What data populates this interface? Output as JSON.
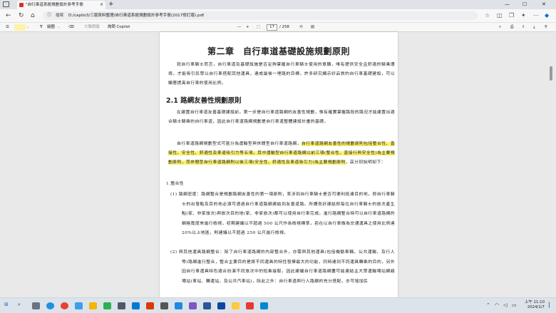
{
  "browser": {
    "tab_title": "\"自行車道系統規劃設計參考手冊",
    "tab_close": "×",
    "new_tab": "+",
    "window_minimize": "—",
    "window_maximize": "☐",
    "window_close": "✕",
    "address_label": "檔案",
    "address_path": "D:/caplio3/三版資料整理/自行車道系統規劃設計參考手冊(2017修訂版).pdf"
  },
  "pdf_toolbar": {
    "draw_label": "繪圖",
    "read_aloud": "大聲朗讀",
    "copilot": "詢問 Copilot",
    "zoom_out": "—",
    "zoom_in": "+",
    "current_page": "17",
    "total_pages": "/ 258"
  },
  "document": {
    "chapter_title": "第二章　自行車道基礎設施規劃原則",
    "intro_paragraph": "就自行車騎士而言，自行車道及基礎設施是否足夠掌握自行車騎士使用的意願，唯有提供安全且舒適的騎乘環境，才能吸引民眾以自行車搭配其他運具，達成最後一哩路的目標，許多研究顯示好品質的自行車基礎建設，可以顯著提高自行車的使用比例。",
    "section_title": "2.1 路網友善性規劃原則",
    "paragraph_1": "在建置自行車道友善基礎建設前，第一步是自行車道路網的友善性規劃，惟有確實掌握路段的路況才能建置出適合騎士騎乘的自行車道，因此自行車道路網規劃是自行車道整體建設計畫的基礎。",
    "paragraph_2_plain": "自行車道路網規劃型式可區分為運輸型與休閒型自行車道路網，",
    "paragraph_2_highlight": "自行車道路網友善性的規劃原則包括整合性、直接性、安全性、舒適性及車道吸引力等五項，其中運輸型自行車道路網以前三項(整合性、直接行與安全性)為主要規劃原則，而休閒型自行車道路網則以後三項(安全性、舒適性及車道吸引力)為主要規劃原則",
    "paragraph_2_tail": "，茲分別說明如下：",
    "list_heading": "1.整合性",
    "item_1": "(1) 路網密度：路網整合是規劃路網友善性的第一項原則，率涉到自行車騎士是否可便利抵達目的地，即自行車騎士的出發點及目的地必須可透過自行車道路網連結到友善道路。所謂良好連結即每位自行車騎士的旅次產生點(家、非家旅次)與旅次目的地(家、非家旅次)都可以使用自行車完成。進行路網整合時可以自行車道路網的網格寬度來進行檢視，初期建議以不超過 500 公尺作為檢視標準，若在以自行車做為交通運具之使用比例達 20%以上地區，則建議以不超過 250 公尺進行檢視。",
    "item_2": "(2) 與其他運具路網整合：除了自行車道路網的內部整合外，亦需與其他運具(包括機動車輛、公共運輸、及行人等)路網進行整合，整合主要目的是將不同運具的特性發揮最大的功能，同時達到不同運具轉乘的目的，另外因自行車運具特色適合扮演不同旅次中的短乘接駁，因此建議自行車道路網盡可能連結主大眾運輸場站網絡場站(車站、轉運站、及公共汽車站)，除此之外：自行車道與行人路網的充分搭配，亦可增加民"
  },
  "taskbar": {
    "time": "上午 11:10",
    "date": "2024/1/7"
  },
  "colors": {
    "highlight": "#fff36b",
    "edge_blue": "#0a6cd0"
  }
}
